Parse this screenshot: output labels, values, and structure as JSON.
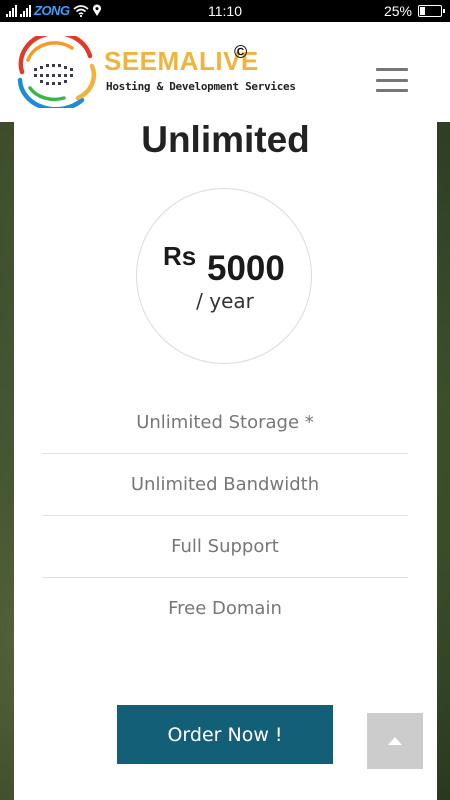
{
  "status_bar": {
    "carrier": "ZONG",
    "time": "11:10",
    "battery_percent": "25%",
    "battery_level": 0.25,
    "icons": [
      "signal-icon",
      "wifi-icon",
      "location-icon",
      "battery-icon"
    ]
  },
  "header": {
    "brand_name": "SEEMALIVE",
    "copyright_symbol": "©",
    "tagline": "Hosting & Development Services",
    "menu_icon": "hamburger-menu-icon"
  },
  "plan": {
    "title": "Unlimited",
    "currency": "Rs",
    "amount": "5000",
    "period": "/ year",
    "features": [
      "Unlimited Storage *",
      "Unlimited Bandwidth",
      "Full Support",
      "Free Domain"
    ],
    "order_label": "Order Now !"
  },
  "scroll_top": {
    "icon": "chevron-up-icon"
  },
  "colors": {
    "brand_orange": "#f0b43c",
    "order_button": "#145f78",
    "card": "#ffffff",
    "divider": "#e2e2e2"
  }
}
